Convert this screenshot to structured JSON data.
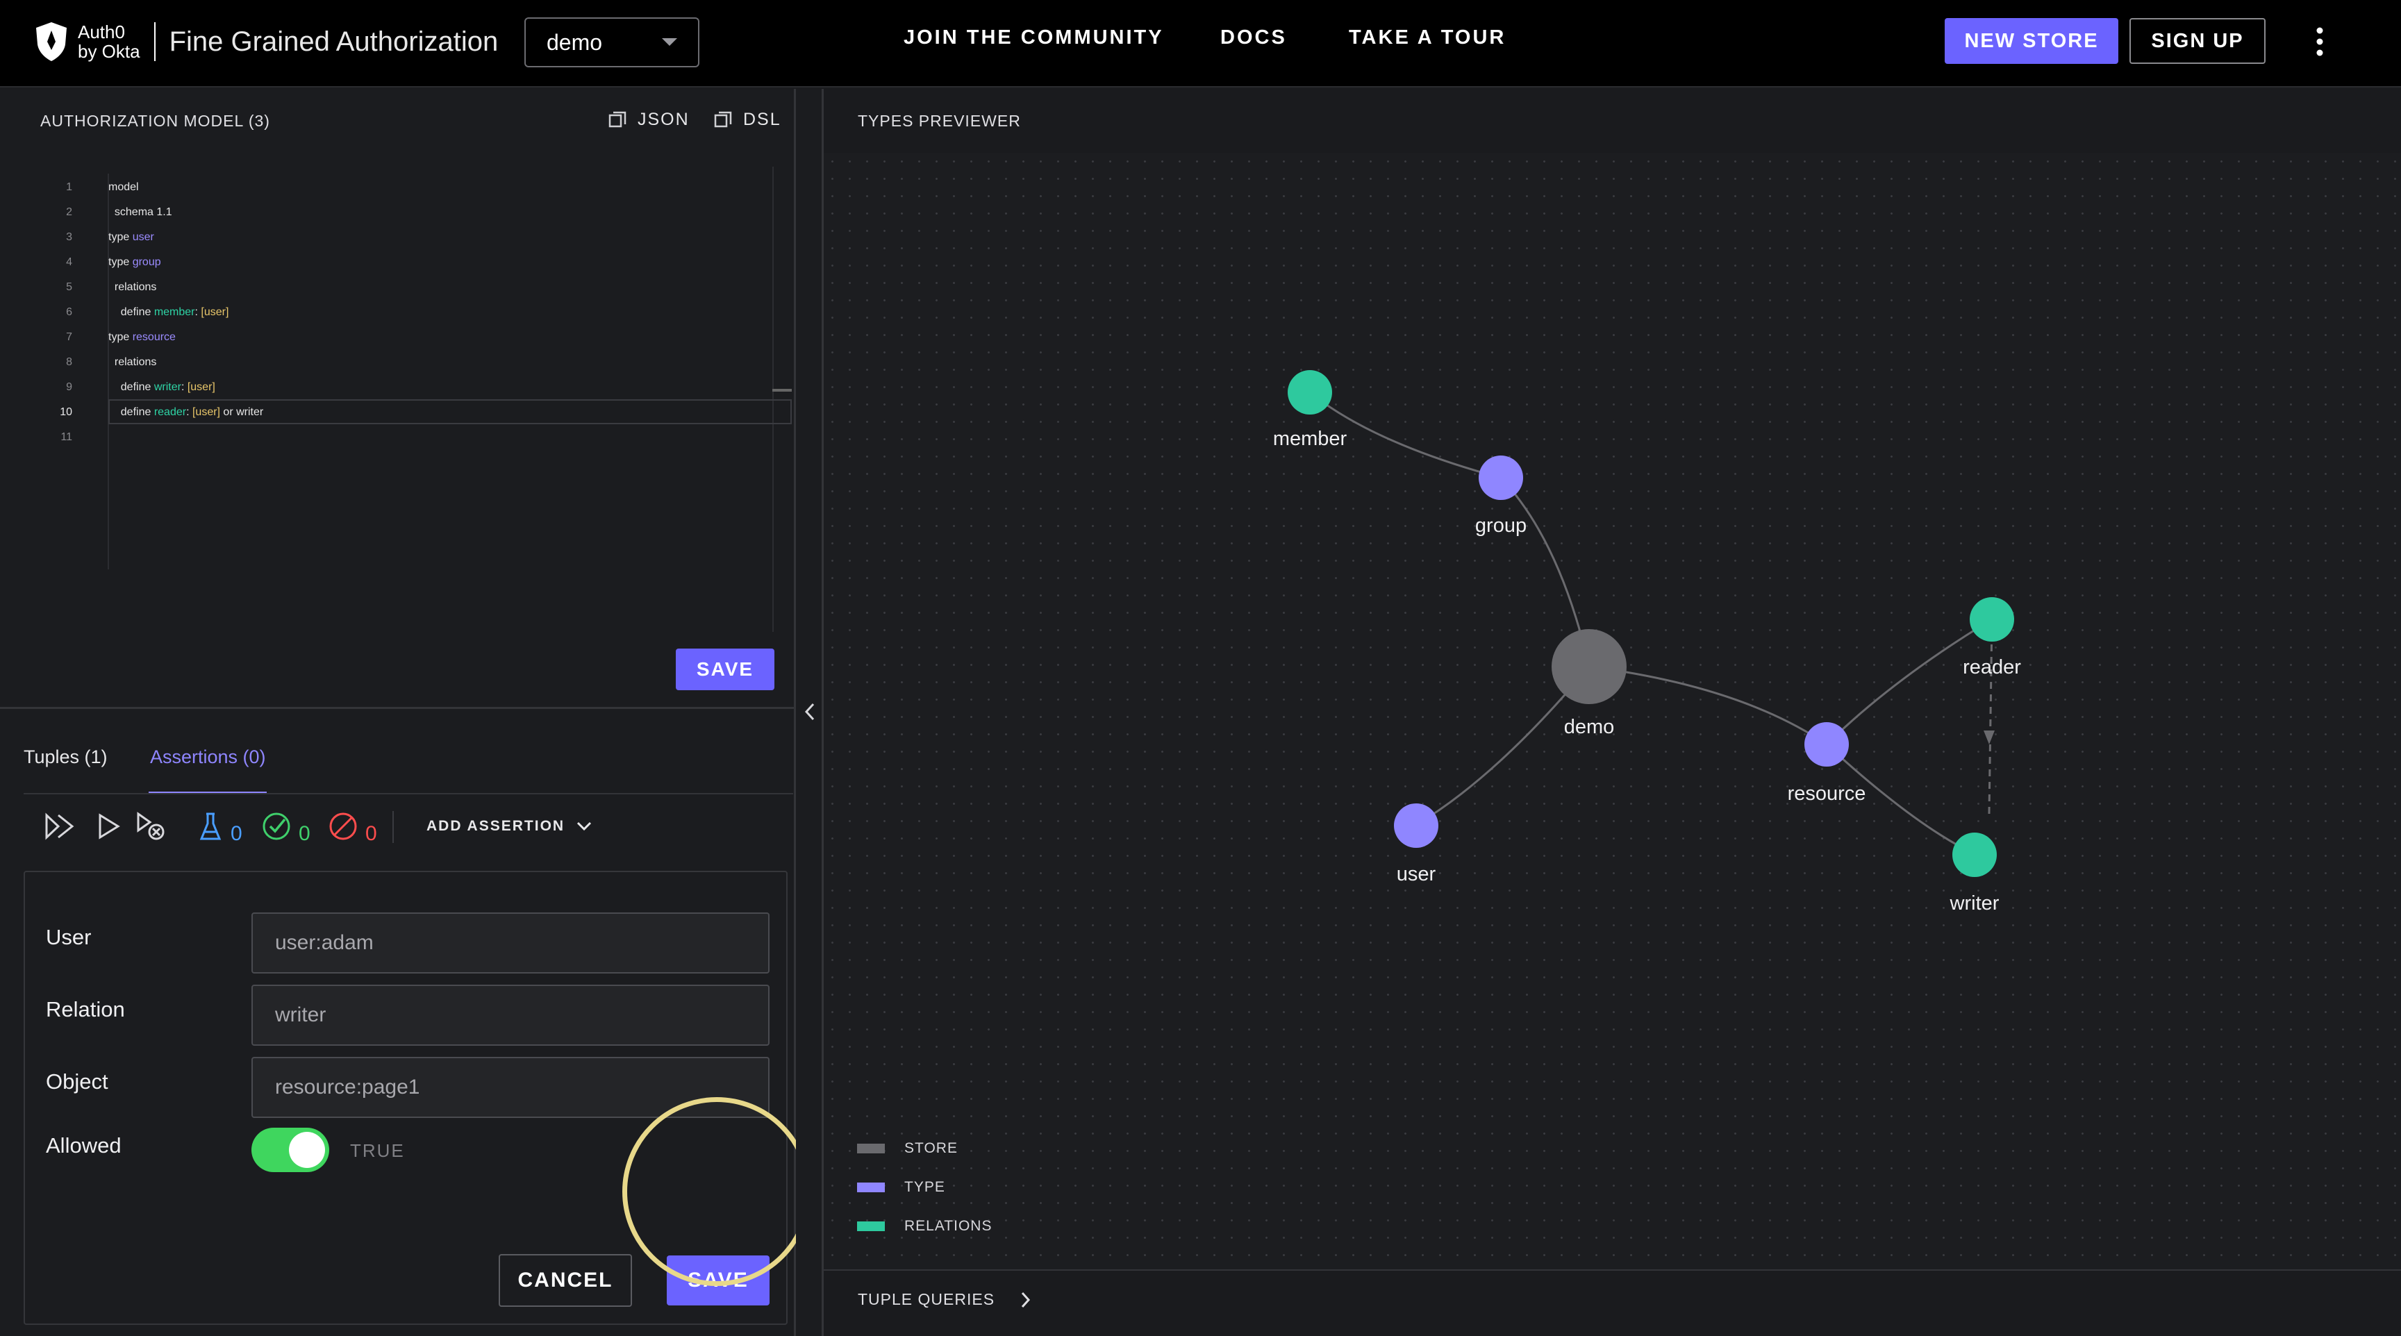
{
  "header": {
    "brand_line1": "Auth0",
    "brand_line2": "by Okta",
    "app_title": "Fine Grained Authorization",
    "store_value": "demo",
    "nav": [
      "JOIN THE COMMUNITY",
      "DOCS",
      "TAKE A TOUR"
    ],
    "new_store": "NEW STORE",
    "sign_up": "SIGN UP"
  },
  "model_panel": {
    "title": "AUTHORIZATION MODEL (3)",
    "json_label": "JSON",
    "dsl_label": "DSL",
    "save_label": "SAVE",
    "active_line": 10,
    "lines": [
      {
        "n": "1",
        "parts": [
          {
            "t": "model",
            "c": "kw"
          }
        ]
      },
      {
        "n": "2",
        "parts": [
          {
            "t": "  schema ",
            "c": "kw"
          },
          {
            "t": "1.1",
            "c": "kw"
          }
        ]
      },
      {
        "n": "3",
        "parts": [
          {
            "t": "type ",
            "c": "kw"
          },
          {
            "t": "user",
            "c": "ty"
          }
        ]
      },
      {
        "n": "4",
        "parts": [
          {
            "t": "type ",
            "c": "kw"
          },
          {
            "t": "group",
            "c": "ty"
          }
        ]
      },
      {
        "n": "5",
        "parts": [
          {
            "t": "  relations",
            "c": "kw"
          }
        ]
      },
      {
        "n": "6",
        "parts": [
          {
            "t": "    define ",
            "c": "kw"
          },
          {
            "t": "member",
            "c": "rel"
          },
          {
            "t": ": ",
            "c": "kw"
          },
          {
            "t": "[user]",
            "c": "br"
          }
        ]
      },
      {
        "n": "7",
        "parts": [
          {
            "t": "type ",
            "c": "kw"
          },
          {
            "t": "resource",
            "c": "ty"
          }
        ]
      },
      {
        "n": "8",
        "parts": [
          {
            "t": "  relations",
            "c": "kw"
          }
        ]
      },
      {
        "n": "9",
        "parts": [
          {
            "t": "    define ",
            "c": "kw"
          },
          {
            "t": "writer",
            "c": "rel"
          },
          {
            "t": ": ",
            "c": "kw"
          },
          {
            "t": "[user]",
            "c": "br"
          }
        ]
      },
      {
        "n": "10",
        "parts": [
          {
            "t": "    define ",
            "c": "kw"
          },
          {
            "t": "reader",
            "c": "rel"
          },
          {
            "t": ": ",
            "c": "kw"
          },
          {
            "t": "[user]",
            "c": "br"
          },
          {
            "t": " or writer",
            "c": "kw"
          }
        ]
      },
      {
        "n": "11",
        "parts": []
      }
    ]
  },
  "tabs": {
    "tuples": "Tuples (1)",
    "assertions": "Assertions (0)",
    "active": "assertions"
  },
  "assertions_toolbar": {
    "total_count": "0",
    "passed_count": "0",
    "failed_count": "0",
    "add_assertion": "ADD ASSERTION",
    "colors": {
      "total": "#4a9eff",
      "passed": "#3fcf6b",
      "failed": "#ff4d4d"
    }
  },
  "assertion_form": {
    "user_label": "User",
    "user_value": "user:adam",
    "relation_label": "Relation",
    "relation_value": "writer",
    "object_label": "Object",
    "object_value": "resource:page1",
    "allowed_label": "Allowed",
    "allowed_state": "TRUE",
    "allowed_on": true,
    "cancel": "CANCEL",
    "save": "SAVE"
  },
  "preview": {
    "title": "TYPES PREVIEWER",
    "nodes": [
      "member",
      "group",
      "demo",
      "user",
      "resource",
      "reader",
      "writer"
    ],
    "legend": [
      {
        "label": "STORE",
        "color": "#6a6a6e"
      },
      {
        "label": "TYPE",
        "color": "#8f86ff"
      },
      {
        "label": "RELATIONS",
        "color": "#2ec99e"
      }
    ],
    "tuple_queries": "TUPLE QUERIES"
  },
  "colors": {
    "accent": "#6b63ff",
    "type_node": "#8f86ff",
    "relation_node": "#2ec99e",
    "store_node": "#6a6a6e",
    "toggle_on": "#3fd65e",
    "highlight_ring": "#e8d88a"
  }
}
